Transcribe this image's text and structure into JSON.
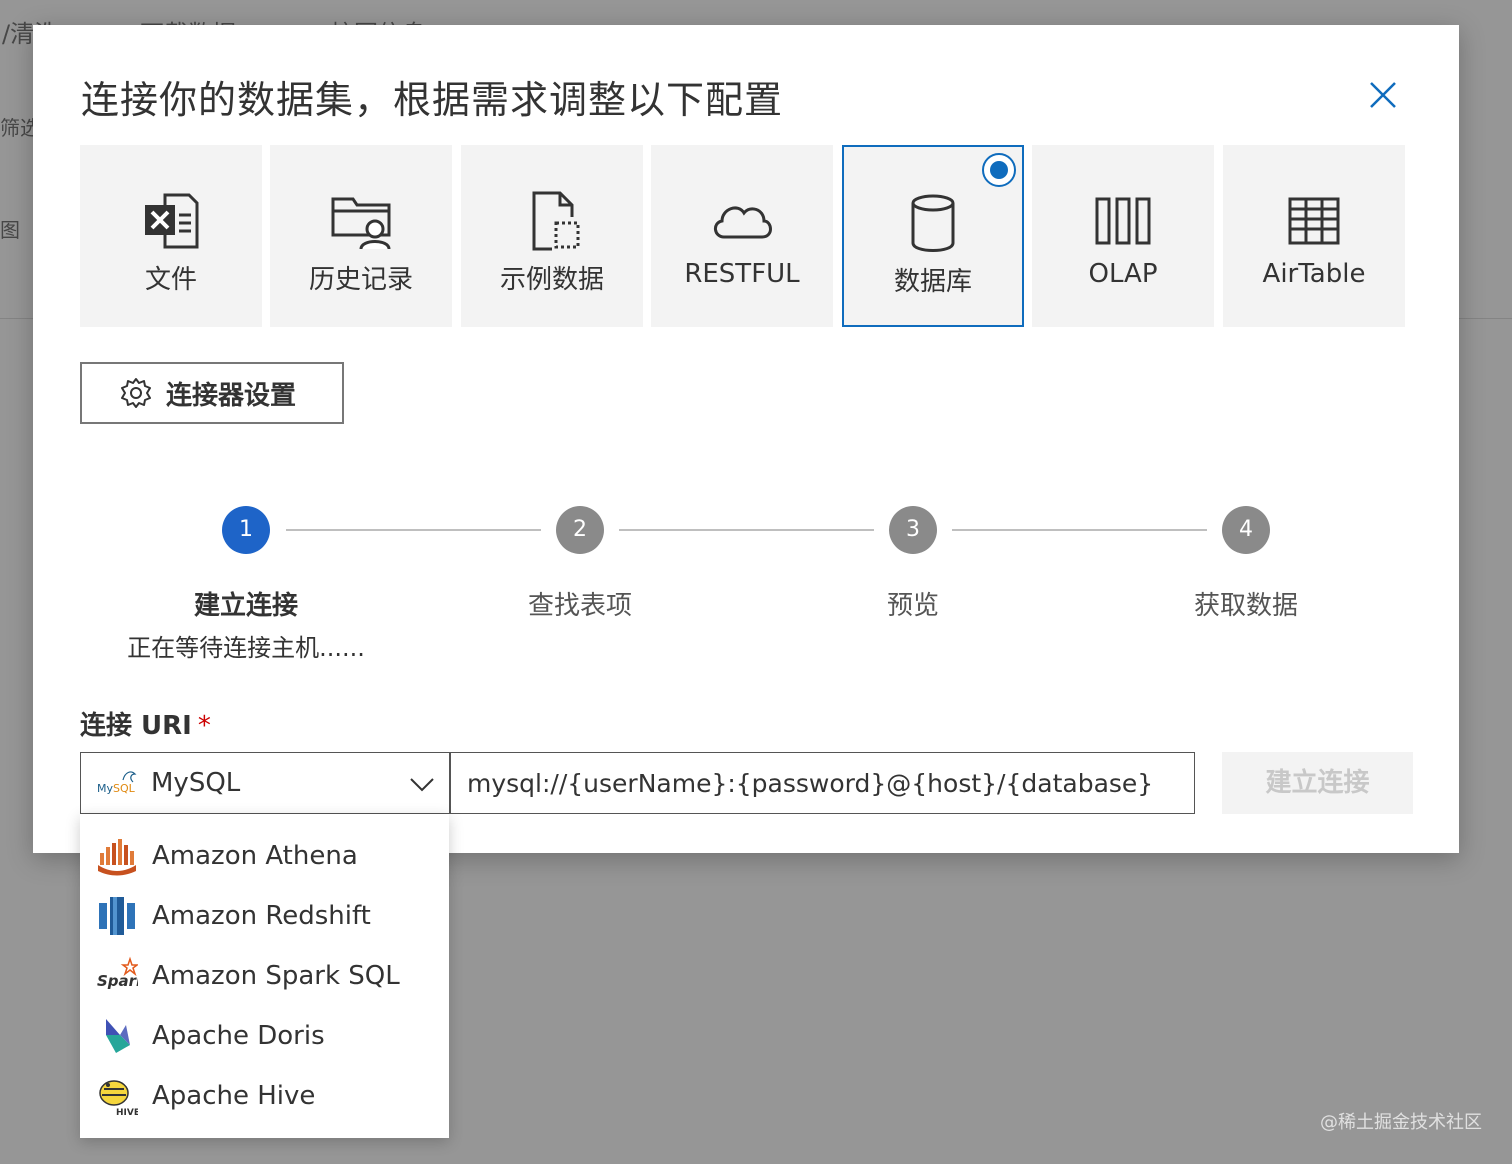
{
  "background": {
    "items": [
      "/清洗",
      "下载数据",
      "校园信息",
      "筛选",
      "图"
    ]
  },
  "watermark": "@稀土掘金技术社区",
  "dialog": {
    "title": "连接你的数据集，根据需求调整以下配置",
    "sources": [
      {
        "label": "文件",
        "icon": "excel-file-icon"
      },
      {
        "label": "历史记录",
        "icon": "folder-user-icon"
      },
      {
        "label": "示例数据",
        "icon": "sample-file-icon"
      },
      {
        "label": "RESTFUL",
        "icon": "cloud-icon"
      },
      {
        "label": "数据库",
        "icon": "database-icon",
        "selected": true
      },
      {
        "label": "OLAP",
        "icon": "columns-icon"
      },
      {
        "label": "AirTable",
        "icon": "table-icon"
      }
    ],
    "connector_settings_label": "连接器设置",
    "steps": [
      {
        "number": "1",
        "title": "建立连接",
        "subtitle": "正在等待连接主机......",
        "active": true
      },
      {
        "number": "2",
        "title": "查找表项"
      },
      {
        "number": "3",
        "title": "预览"
      },
      {
        "number": "4",
        "title": "获取数据"
      }
    ],
    "uri_label": "连接 URI",
    "required_mark": "*",
    "db_select_value": "MySQL",
    "uri_value": "mysql://{userName}:{password}@{host}/{database}",
    "connect_button": "建立连接",
    "colors": {
      "accent": "#0f6cbd",
      "step_active": "#1e64c8",
      "step_inactive": "#8a8a8a"
    }
  },
  "dropdown": {
    "options": [
      {
        "label": "Amazon Athena",
        "icon": "athena-icon"
      },
      {
        "label": "Amazon Redshift",
        "icon": "redshift-icon"
      },
      {
        "label": "Amazon Spark SQL",
        "icon": "spark-icon"
      },
      {
        "label": "Apache Doris",
        "icon": "doris-icon"
      },
      {
        "label": "Apache Hive",
        "icon": "hive-icon"
      }
    ]
  }
}
